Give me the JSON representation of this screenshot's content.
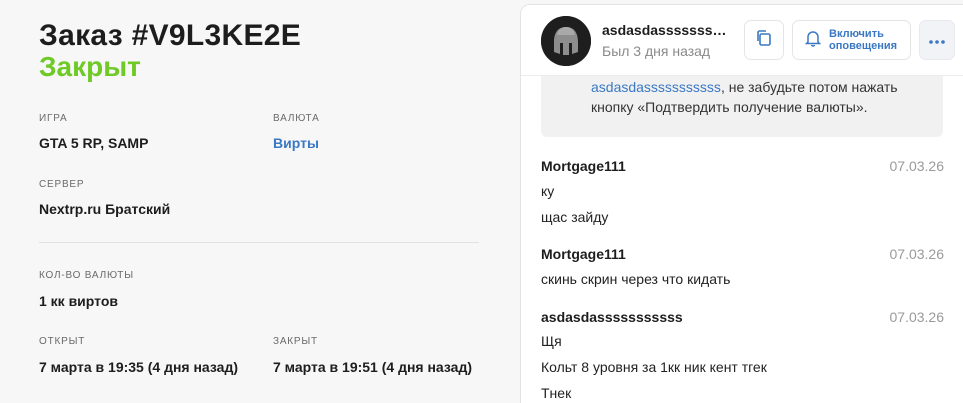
{
  "order": {
    "title": "Заказ #V9L3KE2E",
    "status": "Закрыт"
  },
  "details": {
    "game_label": "ИГРА",
    "game_value": "GTA 5 RP, SAMP",
    "currency_label": "ВАЛЮТА",
    "currency_value": "Вирты",
    "server_label": "СЕРВЕР",
    "server_value": "Nextrp.ru Братский",
    "amount_label": "КОЛ-ВО ВАЛЮТЫ",
    "amount_value": "1 кк виртов",
    "opened_label": "ОТКРЫТ",
    "opened_value": "7 марта в 19:35 (4 дня назад)",
    "closed_label": "ЗАКРЫТ",
    "closed_value": "7 марта в 19:51 (4 дня назад)"
  },
  "chat": {
    "username": "asdasdasssssssssss",
    "last_seen": "Был 3 дня назад",
    "notify_line1": "Включить",
    "notify_line2": "оповещения",
    "system_link": "asdasdasssssssssss",
    "system_rest1": ", не забудьте потом нажать",
    "system_rest2": "кнопку «Подтвердить получение валюты».",
    "messages": [
      {
        "author": "Mortgage111",
        "date": "07.03.26",
        "lines": [
          "ку",
          "щас зайду"
        ]
      },
      {
        "author": "Mortgage111",
        "date": "07.03.26",
        "lines": [
          "скинь скрин через что кидать"
        ]
      },
      {
        "author": "asdasdasssssssssss",
        "date": "07.03.26",
        "lines": [
          "Щя",
          "Кольт 8 уровня за 1кк ник кент тгек",
          "Тнек"
        ]
      }
    ]
  },
  "icons": {
    "copy": "copy-icon",
    "bell": "bell-icon",
    "more": "more-dots-icon",
    "avatar": "spartan-helmet-avatar"
  },
  "colors": {
    "status_green": "#6fc926",
    "link_blue": "#3a78c3"
  }
}
